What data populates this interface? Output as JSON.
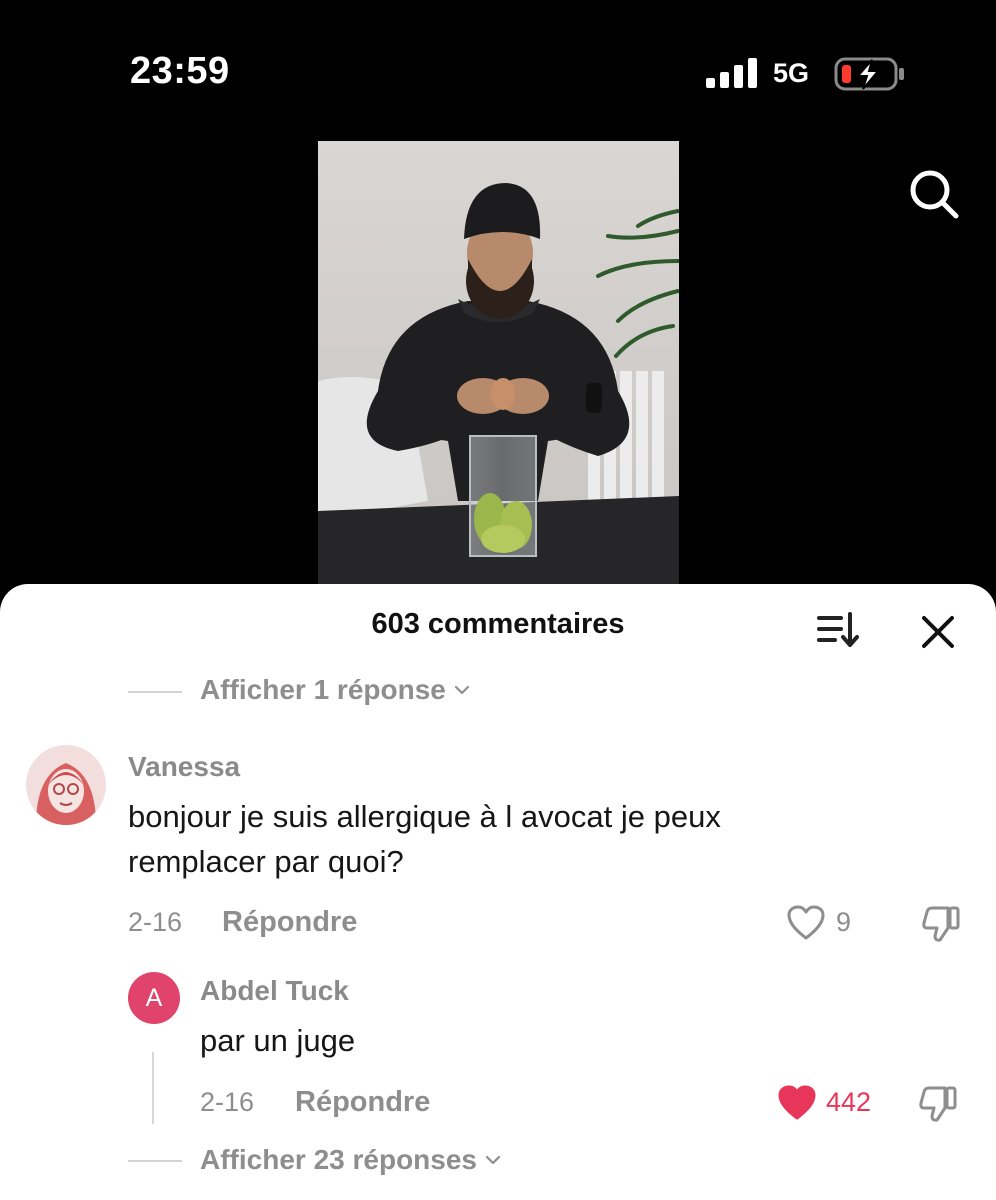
{
  "status": {
    "time": "23:59",
    "network": "5G"
  },
  "comments_sheet": {
    "title": "603 commentaires",
    "show_replies_top": "Afficher 1 réponse",
    "show_replies_bottom": "Afficher 23 réponses"
  },
  "comments": [
    {
      "username": "Vanessa",
      "text_line1": "bonjour je suis allergique à l avocat je peux",
      "text_line2": "remplacer par quoi?",
      "date": "2-16",
      "reply_label": "Répondre",
      "likes": "9",
      "liked": false
    }
  ],
  "replies": [
    {
      "avatar_letter": "A",
      "username": "Abdel Tuck",
      "text": "par un juge",
      "date": "2-16",
      "reply_label": "Répondre",
      "likes": "442",
      "liked": true
    }
  ],
  "colors": {
    "liked": "#e8355a",
    "avatar_reply": "#e0436b",
    "muted": "#8e8e8e"
  },
  "icons": [
    "signal-icon",
    "battery-charging-icon",
    "search-icon",
    "sort-icon",
    "close-icon",
    "chevron-down-icon",
    "heart-icon",
    "dislike-icon"
  ]
}
